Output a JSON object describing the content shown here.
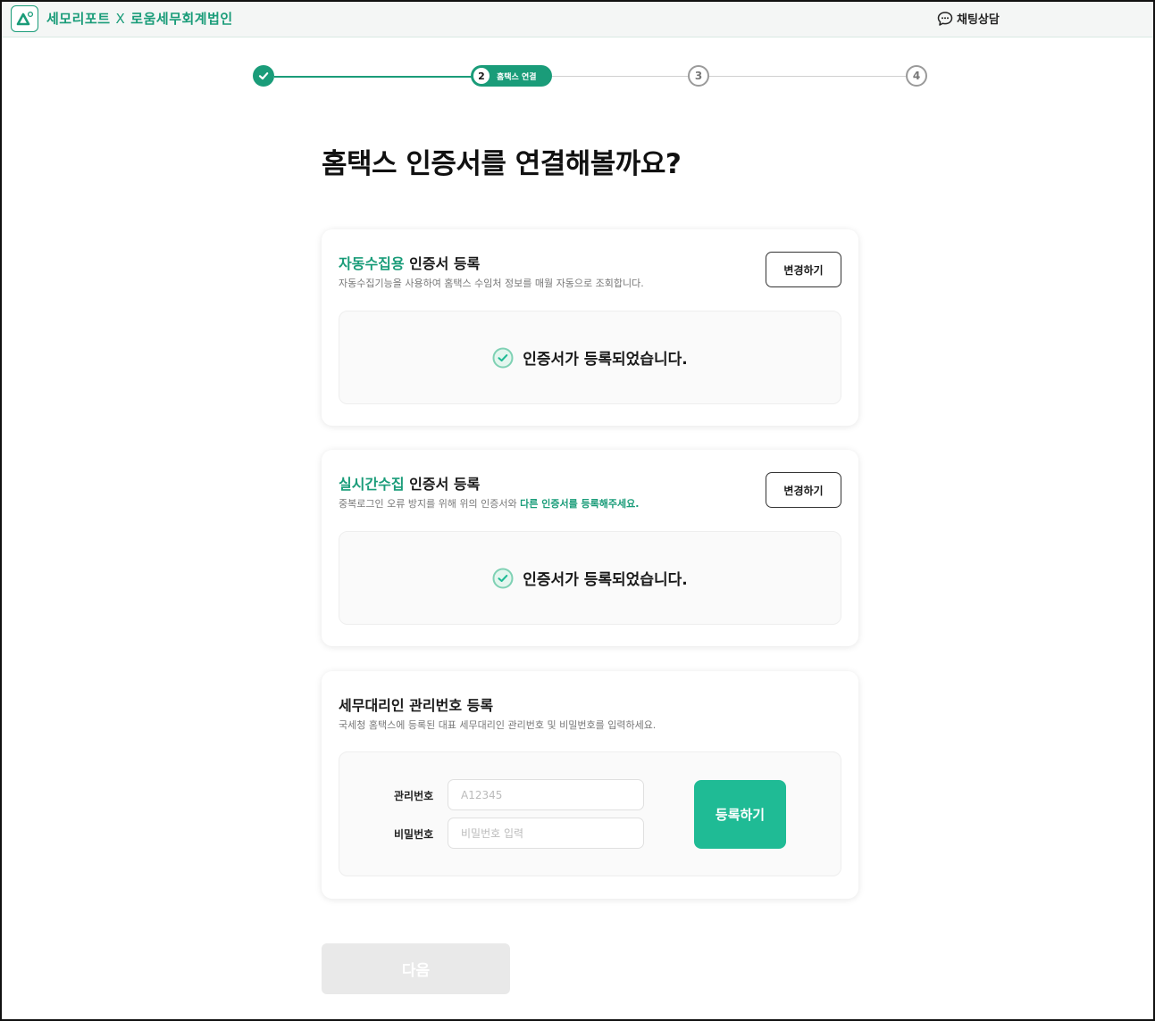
{
  "header": {
    "brand_left": "세모리포트",
    "brand_sep": "X",
    "brand_right": "로움세무회계법인",
    "chat_label": "채팅상담"
  },
  "stepper": {
    "current_number": "2",
    "current_label": "홈택스 연결",
    "step3": "3",
    "step4": "4"
  },
  "page_title": "홈택스 인증서를 연결해볼까요?",
  "card_auto": {
    "title_accent": "자동수집용",
    "title_rest": " 인증서 등록",
    "desc": "자동수집기능을 사용하여 홈택스 수임처 정보를 매월 자동으로 조회합니다.",
    "change_label": "변경하기",
    "status": "인증서가 등록되었습니다."
  },
  "card_realtime": {
    "title_accent": "실시간수집",
    "title_rest": " 인증서 등록",
    "desc_plain": "중복로그인 오류 방지를 위해 위의 인증서와 ",
    "desc_accent": "다른 인증서를 등록해주세요.",
    "change_label": "변경하기",
    "status": "인증서가 등록되었습니다."
  },
  "card_agent": {
    "title": "세무대리인 관리번호 등록",
    "desc": "국세청 홈택스에 등록된 대표 세무대리인 관리번호 및 비밀번호를 입력하세요.",
    "id_label": "관리번호",
    "id_placeholder": "A12345",
    "id_value": "",
    "pw_label": "비밀번호",
    "pw_placeholder": "비밀번호 입력",
    "pw_value": "",
    "register_label": "등록하기"
  },
  "next_label": "다음",
  "colors": {
    "brand": "#1a9c79",
    "button": "#1fbb95",
    "disabled": "#e9e9e9"
  }
}
